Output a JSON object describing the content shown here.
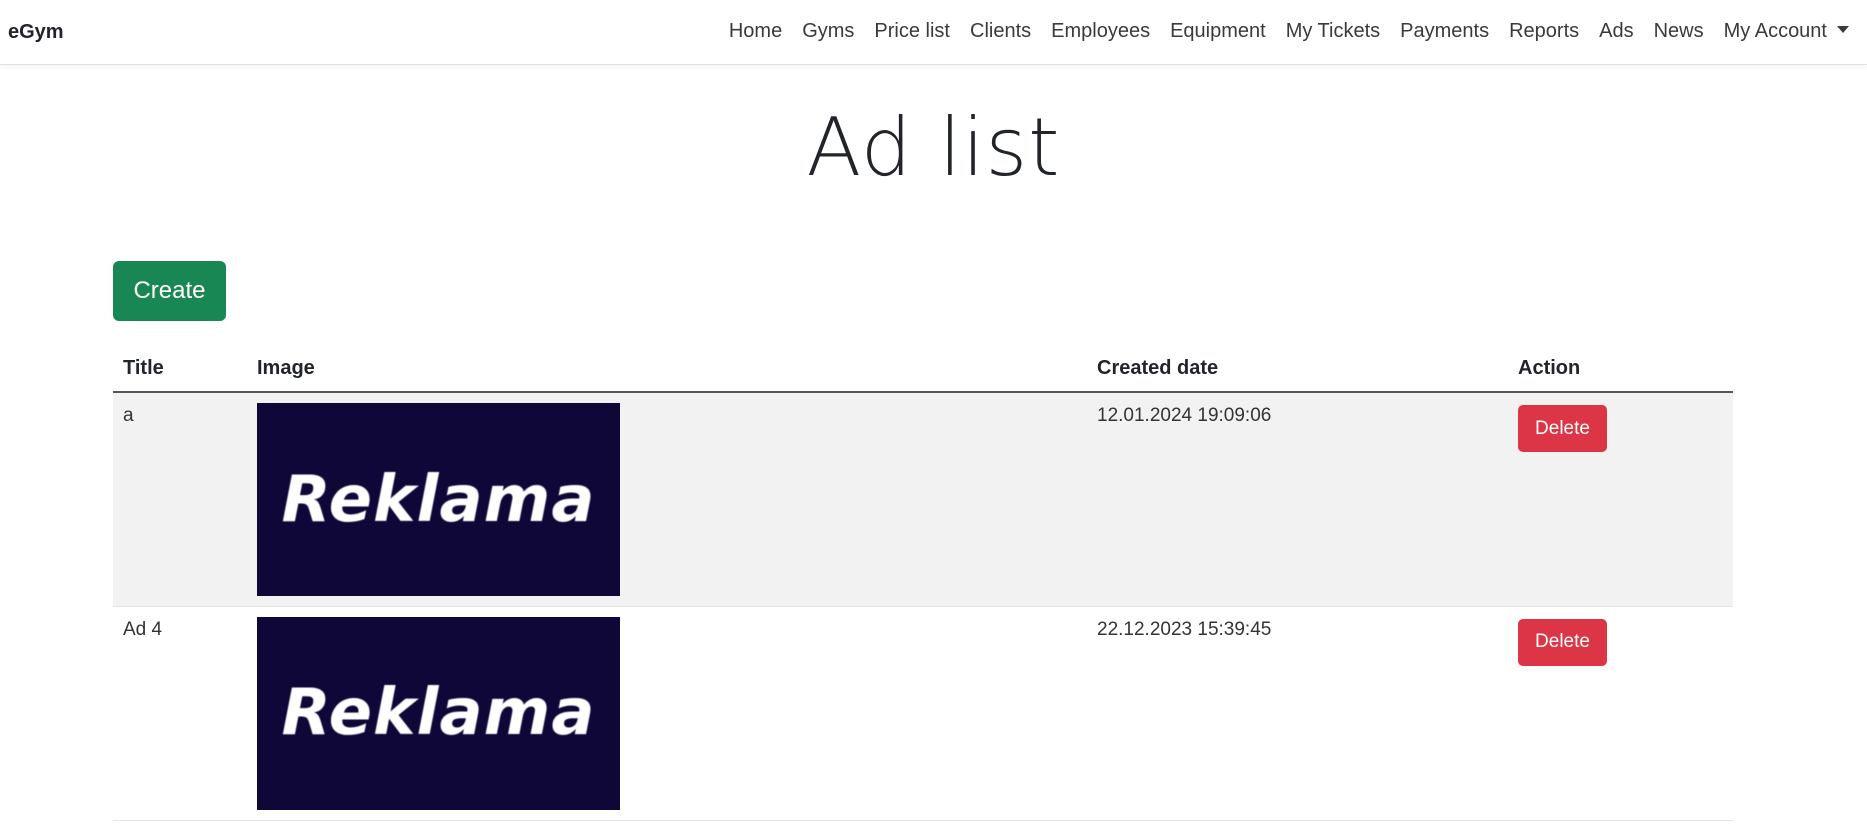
{
  "navbar": {
    "brand": "eGym",
    "links": [
      "Home",
      "Gyms",
      "Price list",
      "Clients",
      "Employees",
      "Equipment",
      "My Tickets",
      "Payments",
      "Reports",
      "Ads",
      "News"
    ],
    "account": "My Account"
  },
  "page": {
    "title": "Ad list",
    "create_label": "Create"
  },
  "table": {
    "headers": {
      "title": "Title",
      "image": "Image",
      "created_date": "Created date",
      "action": "Action"
    },
    "rows": [
      {
        "title": "a",
        "image_text": "Reklama",
        "created_date": "12.01.2024 19:09:06",
        "action_label": "Delete"
      },
      {
        "title": "Ad 4",
        "image_text": "Reklama",
        "created_date": "22.12.2023 15:39:45",
        "action_label": "Delete"
      }
    ]
  },
  "colors": {
    "create_button": "#198754",
    "delete_button": "#dc3545",
    "ad_image_bg": "#0f0738",
    "striped_row": "#f2f2f2"
  }
}
